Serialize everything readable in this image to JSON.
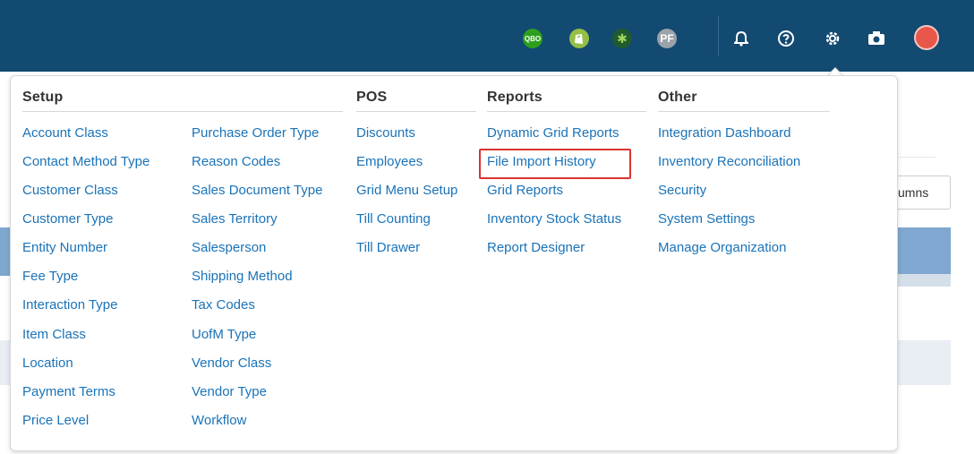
{
  "topbar": {
    "qbo_label": "QBO",
    "pf_label": "PF",
    "icons": [
      "qbo-icon",
      "shopify-icon",
      "gear-app-icon",
      "pf-icon",
      "bell-icon",
      "help-icon",
      "settings-icon",
      "camera-icon",
      "avatar"
    ]
  },
  "background": {
    "columns_button_partial": "umns"
  },
  "menu": {
    "setup": {
      "title": "Setup",
      "col1": [
        "Account Class",
        "Contact Method Type",
        "Customer Class",
        "Customer Type",
        "Entity Number",
        "Fee Type",
        "Interaction Type",
        "Item Class",
        "Location",
        "Payment Terms",
        "Price Level"
      ],
      "col2": [
        "Purchase Order Type",
        "Reason Codes",
        "Sales Document Type",
        "Sales Territory",
        "Salesperson",
        "Shipping Method",
        "Tax Codes",
        "UofM Type",
        "Vendor Class",
        "Vendor Type",
        "Workflow"
      ]
    },
    "pos": {
      "title": "POS",
      "items": [
        "Discounts",
        "Employees",
        "Grid Menu Setup",
        "Till Counting",
        "Till Drawer"
      ]
    },
    "reports": {
      "title": "Reports",
      "items": [
        "Dynamic Grid Reports",
        "File Import History",
        "Grid Reports",
        "Inventory Stock Status",
        "Report Designer"
      ]
    },
    "other": {
      "title": "Other",
      "items": [
        "Integration Dashboard",
        "Inventory Reconciliation",
        "Security",
        "System Settings",
        "Manage Organization"
      ]
    }
  },
  "colors": {
    "topbar": "#124a72",
    "link": "#1a73b8",
    "highlight": "#d93434"
  }
}
